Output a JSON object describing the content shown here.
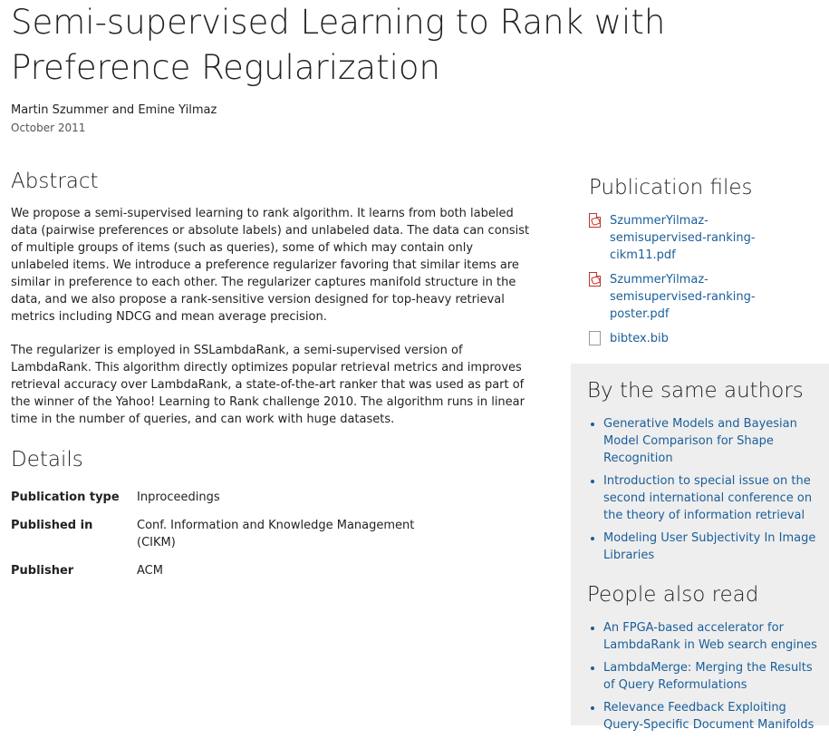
{
  "page": {
    "title": "Semi-supervised Learning to Rank with Preference Regularization",
    "authors": "Martin Szummer and Emine Yilmaz",
    "date": "October 2011"
  },
  "abstract": {
    "heading": "Abstract",
    "paragraphs": [
      "We propose a semi-supervised learning to rank algorithm. It learns from both labeled data (pairwise preferences or absolute labels) and unlabeled data. The data can consist of multiple groups of items (such as queries), some of which may contain only unlabeled items. We introduce a preference regularizer favoring that similar items are similar in preference to each other. The regularizer captures manifold structure in the data, and we also propose a rank-sensitive version designed for top-heavy retrieval metrics including NDCG and mean average precision.",
      "The regularizer is employed in SSLambdaRank, a semi-supervised version of LambdaRank. This algorithm directly optimizes popular retrieval metrics and improves retrieval accuracy over LambdaRank, a state-of-the-art ranker that was used as part of the winner of the Yahoo! Learning to Rank challenge 2010. The algorithm runs in linear time in the number of queries, and can work with huge datasets."
    ]
  },
  "details": {
    "heading": "Details",
    "rows": [
      {
        "key": "Publication type",
        "value": "Inproceedings"
      },
      {
        "key": "Published in",
        "value": "Conf. Information and Knowledge Management (CIKM)"
      },
      {
        "key": "Publisher",
        "value": "ACM"
      }
    ]
  },
  "files": {
    "heading": "Publication files",
    "items": [
      {
        "name": "SzummerYilmaz-semisupervised-ranking-cikm11.pdf",
        "icon": "pdf-icon"
      },
      {
        "name": "SzummerYilmaz-semisupervised-ranking-poster.pdf",
        "icon": "pdf-icon"
      },
      {
        "name": "bibtex.bib",
        "icon": "document-icon"
      }
    ]
  },
  "same_authors": {
    "heading": "By the same authors",
    "items": [
      "Generative Models and Bayesian Model Comparison for Shape Recognition",
      "Introduction to special issue on the second international conference on the theory of information retrieval",
      "Modeling User Subjectivity In Image Libraries"
    ]
  },
  "also_read": {
    "heading": "People also read",
    "items": [
      "An FPGA-based accelerator for LambdaRank in Web search engines",
      "LambdaMerge: Merging the Results of Query Reformulations",
      "Relevance Feedback Exploiting Query-Specific Document Manifolds"
    ]
  },
  "colors": {
    "link": "#1a5e9a",
    "sidebar_background": "#eeeeee",
    "text": "#222222"
  }
}
